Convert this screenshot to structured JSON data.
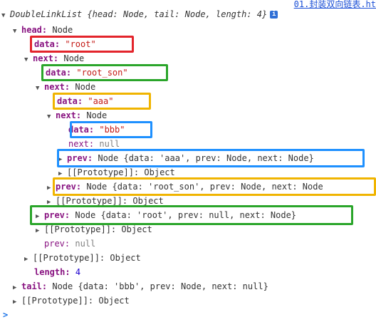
{
  "tab_link": "01.封装双向链表.ht",
  "summary": {
    "class_name": "DoubleLinkList",
    "preview": "{head: Node, tail: Node, length: 4}",
    "info_icon": "i"
  },
  "tree": {
    "head_key": "head:",
    "head_type": "Node",
    "data_key": "data:",
    "next_key": "next:",
    "prev_key": "prev:",
    "type_node": "Node",
    "val_root": "\"root\"",
    "val_root_son": "\"root_son\"",
    "val_aaa": "\"aaa\"",
    "val_bbb": "\"bbb\"",
    "null": "null",
    "prototype_key": "[[Prototype]]:",
    "prototype_val": "Object",
    "prev_aaa": "Node {data: 'aaa', prev: Node, next: Node}",
    "prev_root_son": "Node {data: 'root_son', prev: Node, next: Node",
    "prev_root": "Node {data: 'root', prev: null, next: Node}",
    "length_key": "length:",
    "length_val": "4",
    "tail_key": "tail:",
    "tail_val": "Node {data: 'bbb', prev: Node, next: null}"
  },
  "colors": {
    "red": "#e3242b",
    "green": "#2aa52a",
    "orange": "#f0b400",
    "blue": "#1e90ff"
  }
}
